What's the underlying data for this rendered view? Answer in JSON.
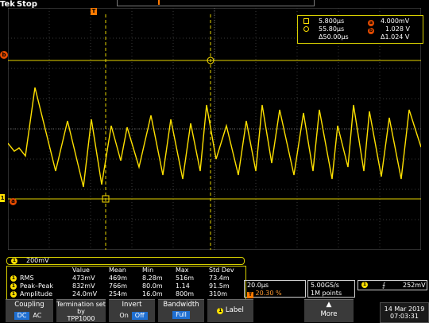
{
  "brand": {
    "tek": "Tek",
    "status": "Stop"
  },
  "cursor_readout": {
    "a_time": "5.800µs",
    "a_volt": "4.000mV",
    "b_time": "55.80µs",
    "b_volt": "1.028 V",
    "delta_time": "Δ50.00µs",
    "delta_volt": "Δ1.024 V",
    "a_label": "a",
    "b_label": "b"
  },
  "markers": {
    "trigger": "T",
    "cursor_b": "b",
    "cursor_a": "a",
    "channel": "1"
  },
  "channel_scale": {
    "channel": "1",
    "scale": "200mV"
  },
  "measurements": {
    "headers": [
      "Value",
      "Mean",
      "Min",
      "Max",
      "Std Dev"
    ],
    "rows": [
      {
        "ch": "1",
        "name": "RMS",
        "value": "473mV",
        "mean": "469m",
        "min": "8.28m",
        "max": "516m",
        "std": "73.4m"
      },
      {
        "ch": "1",
        "name": "Peak–Peak",
        "value": "832mV",
        "mean": "766m",
        "min": "80.0m",
        "max": "1.14",
        "std": "91.5m"
      },
      {
        "ch": "1",
        "name": "Amplitude",
        "value": "24.0mV",
        "mean": "254m",
        "min": "16.0m",
        "max": "800m",
        "std": "310m"
      }
    ]
  },
  "timebase": {
    "per_div": "20.0µs",
    "trigger_pos": "20.30 %",
    "sample_rate": "5.00GS/s",
    "points": "1M points"
  },
  "trigger": {
    "channel": "1",
    "slope_glyph": "⨍",
    "level": "252mV"
  },
  "menu": {
    "coupling_label": "Coupling",
    "coupling_dc": "DC",
    "coupling_ac": "AC",
    "termination_label": "Termination set by",
    "termination_value": "TPP1000",
    "invert_label": "Invert",
    "invert_on": "On",
    "invert_off": "Off",
    "bandwidth_label": "Bandwidth",
    "bandwidth_value": "Full",
    "label_ch": "1",
    "label_label": "Label",
    "more_label": "More"
  },
  "datetime": {
    "date": "14 Mar 2019",
    "time": "07:03:31"
  },
  "colors": {
    "trace": "#ffe100",
    "accent": "#1f6fd1",
    "cursor_b_orange": "#e24a00"
  }
}
